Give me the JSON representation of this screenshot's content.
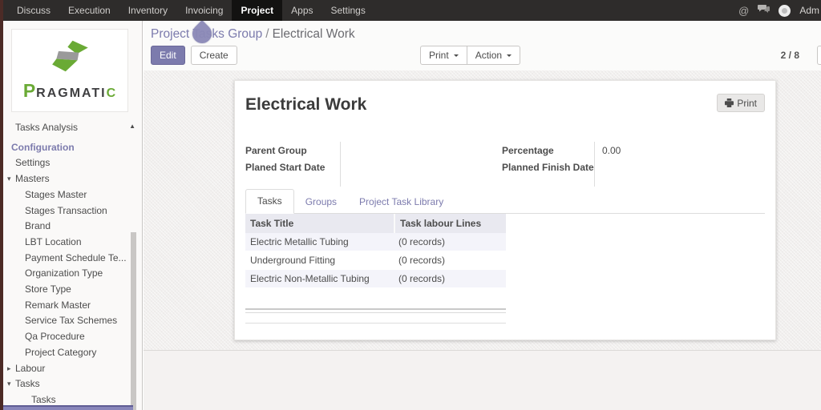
{
  "colors": {
    "accent": "#7c7bad",
    "topbar_bg": "#2e2c2b",
    "topbar_active_bg": "#131211",
    "left_edge_stripe": "#4c2b26",
    "logo_green": "#6aaa35",
    "logo_dark": "#3f3f41",
    "table_header_bg": "#e9e9f0",
    "row_stripe": "#f4f4fa",
    "touch_indicator": "#8b89b7"
  },
  "topbar": {
    "menu": [
      {
        "label": "Discuss",
        "active": false
      },
      {
        "label": "Execution",
        "active": false
      },
      {
        "label": "Inventory",
        "active": false
      },
      {
        "label": "Invoicing",
        "active": false
      },
      {
        "label": "Project",
        "active": true
      },
      {
        "label": "Apps",
        "active": false
      },
      {
        "label": "Settings",
        "active": false
      }
    ],
    "user_label": "Adm"
  },
  "sidebar": {
    "logo_text": {
      "first": "P",
      "middle": "RAGMATI",
      "last": "C"
    },
    "items": [
      {
        "label": "Tasks Analysis",
        "type": "item",
        "level": 0
      },
      {
        "label": "Configuration",
        "type": "section",
        "level": 0
      },
      {
        "label": "Settings",
        "type": "item",
        "level": 0
      },
      {
        "label": "Masters",
        "type": "item",
        "level": 0,
        "arrow": "down"
      },
      {
        "label": "Stages Master",
        "type": "item",
        "level": 1
      },
      {
        "label": "Stages Transaction",
        "type": "item",
        "level": 1
      },
      {
        "label": "Brand",
        "type": "item",
        "level": 1
      },
      {
        "label": "LBT Location",
        "type": "item",
        "level": 1
      },
      {
        "label": "Payment Schedule Te...",
        "type": "item",
        "level": 1
      },
      {
        "label": "Organization Type",
        "type": "item",
        "level": 1
      },
      {
        "label": "Store Type",
        "type": "item",
        "level": 1
      },
      {
        "label": "Remark Master",
        "type": "item",
        "level": 1
      },
      {
        "label": "Service Tax Schemes",
        "type": "item",
        "level": 1
      },
      {
        "label": "Qa Procedure",
        "type": "item",
        "level": 1
      },
      {
        "label": "Project Category",
        "type": "item",
        "level": 1
      },
      {
        "label": "Labour",
        "type": "item",
        "level": 0,
        "arrow": "right"
      },
      {
        "label": "Tasks",
        "type": "item",
        "level": 0,
        "arrow": "down"
      },
      {
        "label": "Tasks",
        "type": "item",
        "level": 2
      }
    ]
  },
  "control_panel": {
    "breadcrumb": {
      "parent": "Project Tasks Group",
      "separator": "/",
      "current": "Electrical Work"
    },
    "edit_label": "Edit",
    "create_label": "Create",
    "print_label": "Print",
    "action_label": "Action",
    "pager": "2 / 8"
  },
  "form": {
    "title": "Electrical Work",
    "print_button": "Print",
    "fields": {
      "left": [
        {
          "label": "Parent Group",
          "value": ""
        },
        {
          "label": "Planed Start Date",
          "value": ""
        }
      ],
      "right": [
        {
          "label": "Percentage",
          "value": "0.00"
        },
        {
          "label": "Planned Finish Date",
          "value": ""
        }
      ]
    },
    "tabs": [
      {
        "label": "Tasks",
        "active": true
      },
      {
        "label": "Groups",
        "active": false
      },
      {
        "label": "Project Task Library",
        "active": false
      }
    ],
    "table": {
      "headers": [
        "Task Title",
        "Task labour Lines"
      ],
      "rows": [
        [
          "Electric Metallic Tubing",
          "(0 records)"
        ],
        [
          "Underground Fitting",
          "(0 records)"
        ],
        [
          "Electric Non-Metallic Tubing",
          "(0 records)"
        ]
      ]
    }
  }
}
